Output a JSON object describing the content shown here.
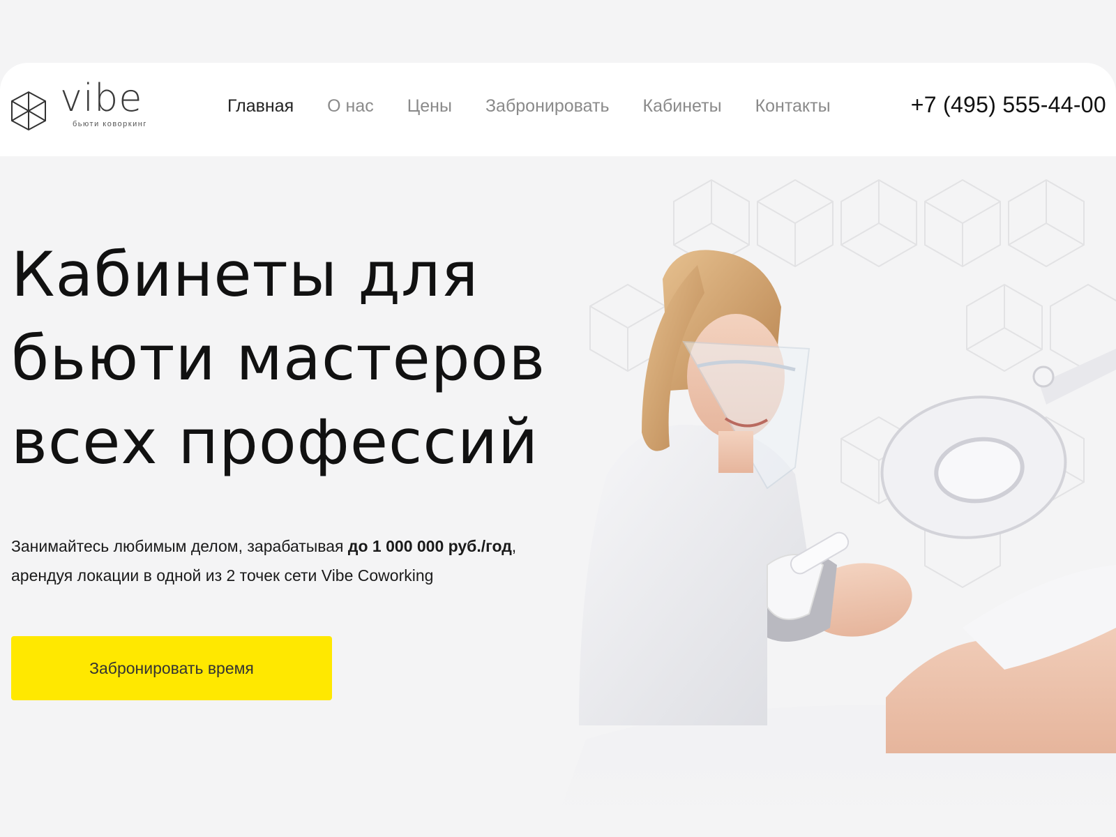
{
  "header": {
    "logo": {
      "word": "vibe",
      "tagline": "бьюти коворкинг"
    },
    "nav": [
      {
        "label": "Главная",
        "active": true
      },
      {
        "label": "О нас",
        "active": false
      },
      {
        "label": "Цены",
        "active": false
      },
      {
        "label": "Забронировать",
        "active": false
      },
      {
        "label": "Кабинеты",
        "active": false
      },
      {
        "label": "Контакты",
        "active": false
      }
    ],
    "phone": "+7 (495) 555-44-00"
  },
  "hero": {
    "title_lines": [
      "Кабинеты для",
      "бьюти мастеров",
      "всех профессий"
    ],
    "subtitle_part1": "Занимайтесь любимым делом, зарабатывая ",
    "subtitle_bold": "до 1 000 000 руб./год",
    "subtitle_part2": ",",
    "subtitle_line2": "арендуя локации в одной из 2 точек сети Vibe Coworking",
    "cta_label": "Забронировать время"
  },
  "colors": {
    "accent": "#ffe800",
    "background": "#f4f4f5",
    "header_bg": "#ffffff"
  }
}
